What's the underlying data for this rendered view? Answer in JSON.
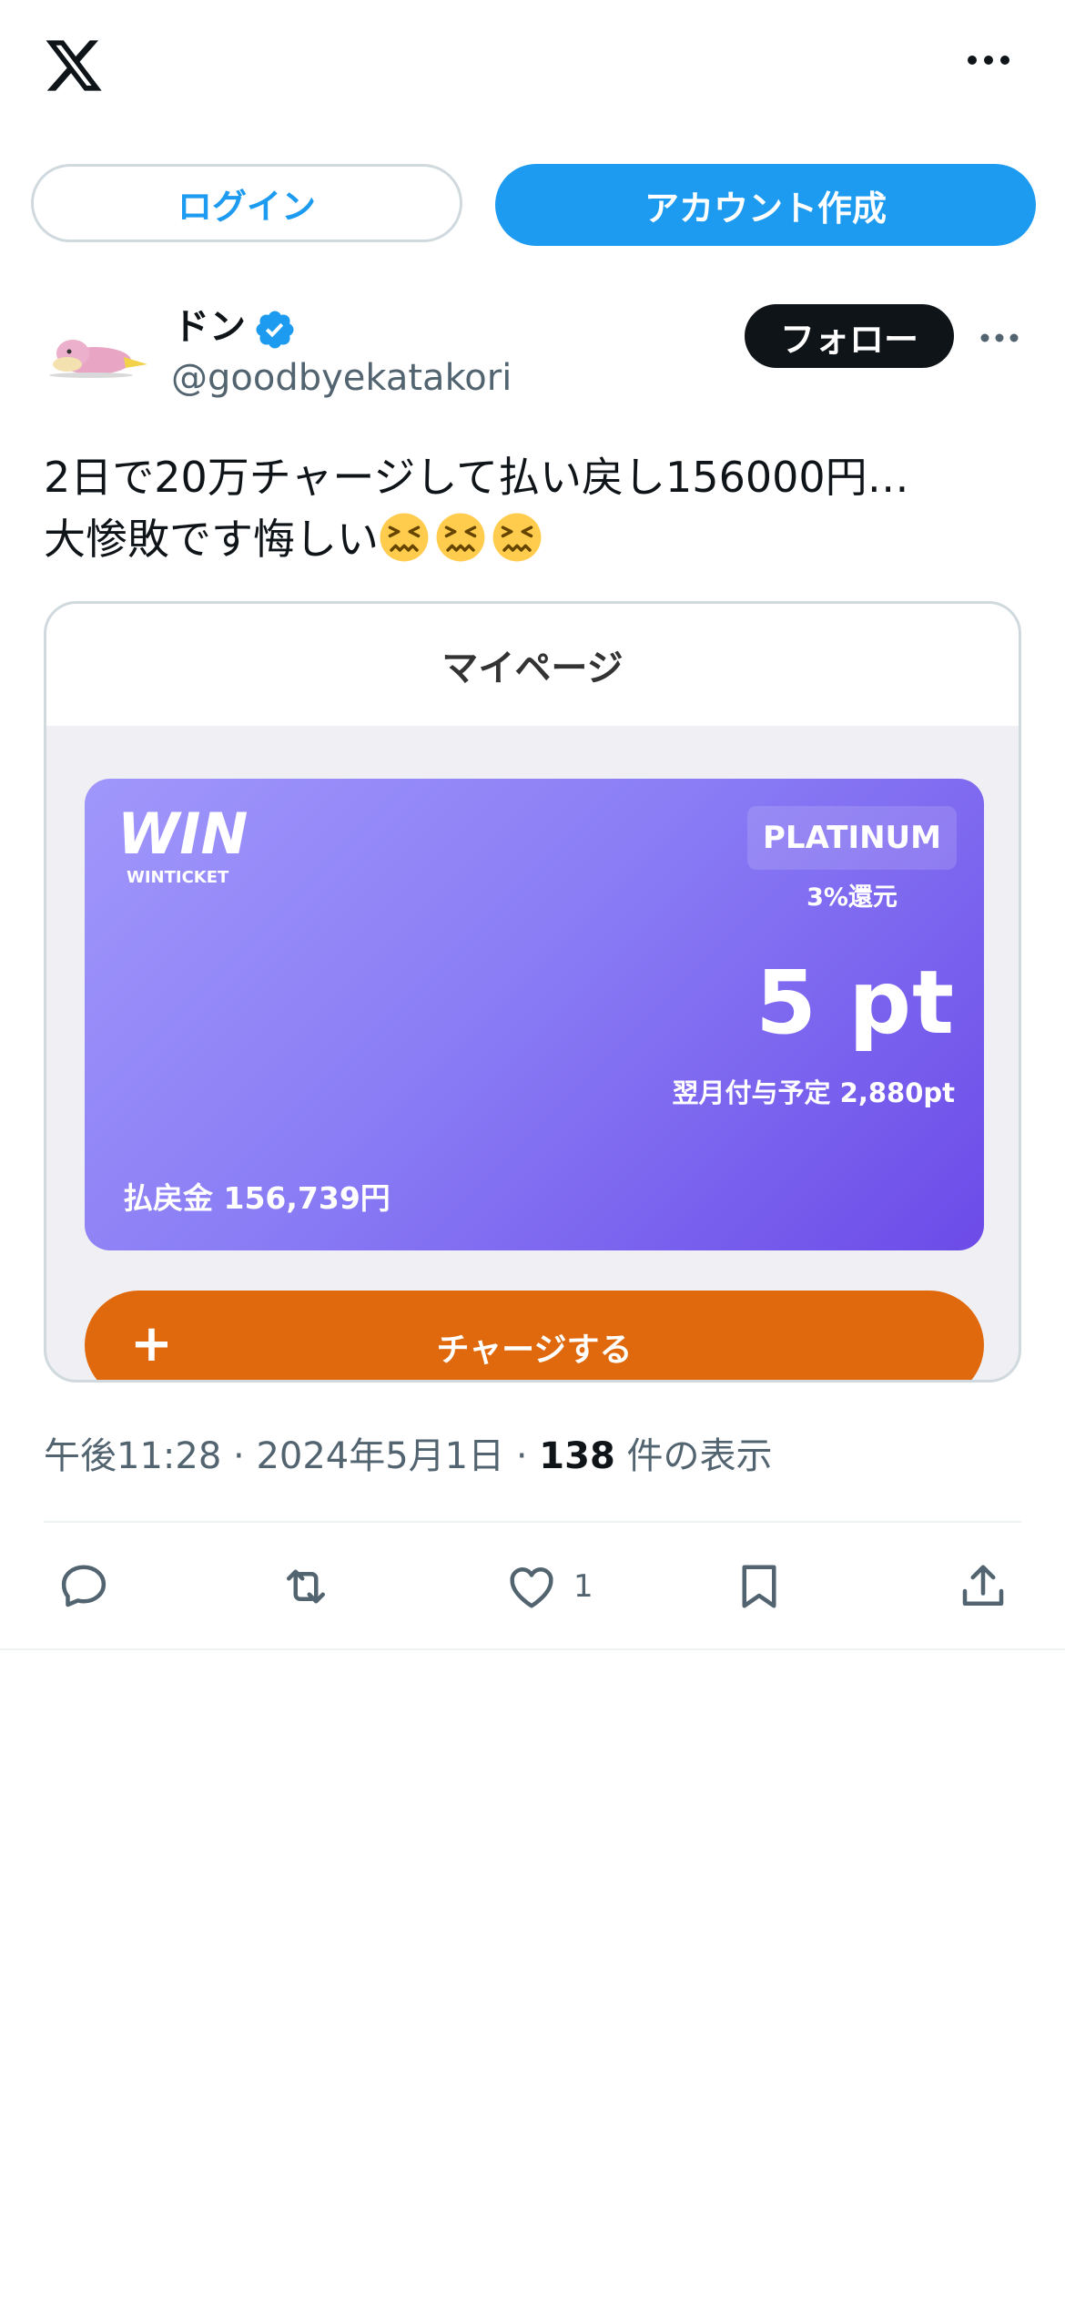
{
  "header": {
    "logo": "x-logo-icon",
    "more": "more-horizontal-icon"
  },
  "auth": {
    "login_label": "ログイン",
    "signup_label": "アカウント作成"
  },
  "author": {
    "name": "ドン",
    "handle": "@goodbyekatakori",
    "follow_label": "フォロー",
    "verified": true
  },
  "tweet": {
    "line1": "2日で20万チャージして払い戻し156000円…",
    "line2": "大惨敗です悔しい",
    "emoji": "confounded-face-icon"
  },
  "media": {
    "page_title": "マイページ",
    "logo_text": "WIN",
    "logo_sub": "WINTICKET",
    "tier": "PLATINUM",
    "rate": "3%還元",
    "points": "5 pt",
    "next_month": "翌月付与予定 2,880pt",
    "balance": "払戻金 156,739円",
    "charge_label": "チャージする"
  },
  "meta": {
    "time": "午後11:28",
    "date": "2024年5月1日",
    "views_count": "138",
    "views_label": "件の表示"
  },
  "actions": {
    "like_count": "1"
  },
  "colors": {
    "accent": "#1d9bf0",
    "charge": "#e0690d",
    "card_start": "#a097fb",
    "card_end": "#6c4be8"
  }
}
